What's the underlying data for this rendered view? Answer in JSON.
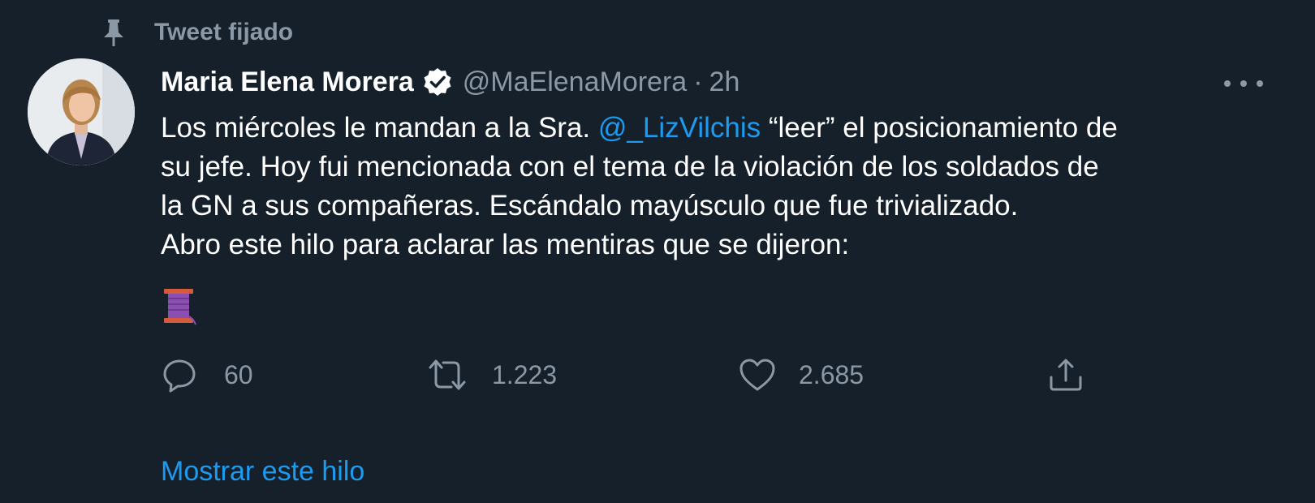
{
  "pinned": {
    "label": "Tweet fijado",
    "icon": "pin-icon"
  },
  "author": {
    "display_name": "Maria Elena Morera",
    "verified": true,
    "handle": "@MaElenaMorera",
    "separator": "·",
    "time": "2h"
  },
  "tweet": {
    "line1_pre": "Los miércoles le mandan a la Sra. ",
    "mention": "@_LizVilchis",
    "line1_post": " “leer” el posicionamiento de",
    "line2": "su jefe. Hoy fui mencionada con el tema de la violación de los soldados de",
    "line3": "la GN a sus compañeras. Escándalo mayúsculo que fue trivializado.",
    "line4": "Abro este hilo para aclarar las mentiras que se dijeron:",
    "emoji": "thread-spool-emoji"
  },
  "actions": {
    "replies": "60",
    "retweets": "1.223",
    "likes": "2.685"
  },
  "show_thread": "Mostrar este hilo",
  "colors": {
    "background": "#15202b",
    "text": "#ffffff",
    "muted": "#8b98a5",
    "link": "#1d9bf0"
  }
}
